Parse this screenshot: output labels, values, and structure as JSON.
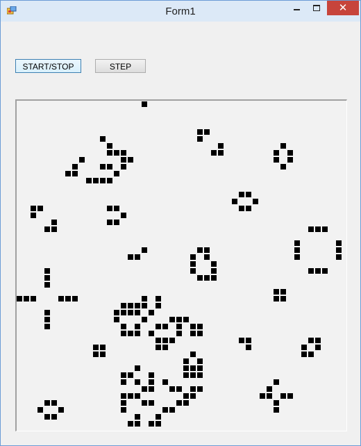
{
  "window": {
    "title": "Form1",
    "close_glyph": "✕"
  },
  "icons": {
    "app": "app-icon",
    "minimize": "minimize-icon",
    "maximize": "maximize-icon",
    "close": "close-icon"
  },
  "controls": {
    "start_stop_label": "START/STOP",
    "step_label": "STEP"
  },
  "colors": {
    "close_button": "#c7443b",
    "titlebar": "#dce9f7",
    "cell": "#000000",
    "board_bg": "#f2f2f2"
  },
  "board": {
    "live_cells": [
      [
        18,
        0
      ],
      [
        26,
        4
      ],
      [
        27,
        4
      ],
      [
        26,
        5
      ],
      [
        29,
        6
      ],
      [
        28,
        7
      ],
      [
        29,
        7
      ],
      [
        12,
        5
      ],
      [
        13,
        6
      ],
      [
        13,
        7
      ],
      [
        14,
        7
      ],
      [
        15,
        7
      ],
      [
        15,
        8
      ],
      [
        16,
        8
      ],
      [
        9,
        8
      ],
      [
        8,
        9
      ],
      [
        7,
        10
      ],
      [
        8,
        10
      ],
      [
        12,
        9
      ],
      [
        13,
        9
      ],
      [
        15,
        9
      ],
      [
        14,
        10
      ],
      [
        10,
        11
      ],
      [
        11,
        11
      ],
      [
        12,
        11
      ],
      [
        13,
        11
      ],
      [
        38,
        6
      ],
      [
        37,
        7
      ],
      [
        39,
        7
      ],
      [
        37,
        8
      ],
      [
        39,
        8
      ],
      [
        38,
        9
      ],
      [
        32,
        13
      ],
      [
        33,
        13
      ],
      [
        31,
        14
      ],
      [
        34,
        14
      ],
      [
        32,
        15
      ],
      [
        33,
        15
      ],
      [
        2,
        15
      ],
      [
        3,
        15
      ],
      [
        2,
        16
      ],
      [
        5,
        17
      ],
      [
        4,
        18
      ],
      [
        5,
        18
      ],
      [
        13,
        15
      ],
      [
        14,
        15
      ],
      [
        15,
        16
      ],
      [
        13,
        17
      ],
      [
        14,
        17
      ],
      [
        42,
        18
      ],
      [
        43,
        18
      ],
      [
        44,
        18
      ],
      [
        40,
        20
      ],
      [
        46,
        20
      ],
      [
        40,
        21
      ],
      [
        46,
        21
      ],
      [
        40,
        22
      ],
      [
        46,
        22
      ],
      [
        42,
        24
      ],
      [
        43,
        24
      ],
      [
        44,
        24
      ],
      [
        18,
        21
      ],
      [
        16,
        22
      ],
      [
        17,
        22
      ],
      [
        26,
        21
      ],
      [
        27,
        21
      ],
      [
        25,
        22
      ],
      [
        27,
        22
      ],
      [
        25,
        23
      ],
      [
        28,
        23
      ],
      [
        25,
        24
      ],
      [
        28,
        24
      ],
      [
        26,
        25
      ],
      [
        27,
        25
      ],
      [
        28,
        25
      ],
      [
        4,
        24
      ],
      [
        4,
        25
      ],
      [
        4,
        26
      ],
      [
        0,
        28
      ],
      [
        1,
        28
      ],
      [
        2,
        28
      ],
      [
        6,
        28
      ],
      [
        7,
        28
      ],
      [
        8,
        28
      ],
      [
        37,
        27
      ],
      [
        38,
        27
      ],
      [
        37,
        28
      ],
      [
        38,
        28
      ],
      [
        18,
        28
      ],
      [
        20,
        28
      ],
      [
        15,
        29
      ],
      [
        16,
        29
      ],
      [
        17,
        29
      ],
      [
        18,
        29
      ],
      [
        20,
        29
      ],
      [
        14,
        30
      ],
      [
        15,
        30
      ],
      [
        16,
        30
      ],
      [
        17,
        30
      ],
      [
        19,
        30
      ],
      [
        14,
        31
      ],
      [
        18,
        31
      ],
      [
        22,
        31
      ],
      [
        23,
        31
      ],
      [
        24,
        31
      ],
      [
        15,
        32
      ],
      [
        17,
        32
      ],
      [
        20,
        32
      ],
      [
        21,
        32
      ],
      [
        23,
        32
      ],
      [
        25,
        32
      ],
      [
        26,
        32
      ],
      [
        15,
        33
      ],
      [
        16,
        33
      ],
      [
        17,
        33
      ],
      [
        19,
        33
      ],
      [
        23,
        33
      ],
      [
        25,
        33
      ],
      [
        26,
        33
      ],
      [
        20,
        34
      ],
      [
        21,
        34
      ],
      [
        22,
        34
      ],
      [
        20,
        35
      ],
      [
        21,
        35
      ],
      [
        4,
        30
      ],
      [
        4,
        31
      ],
      [
        4,
        32
      ],
      [
        11,
        35
      ],
      [
        12,
        35
      ],
      [
        11,
        36
      ],
      [
        12,
        36
      ],
      [
        32,
        34
      ],
      [
        33,
        34
      ],
      [
        33,
        35
      ],
      [
        42,
        34
      ],
      [
        43,
        34
      ],
      [
        41,
        35
      ],
      [
        43,
        35
      ],
      [
        41,
        36
      ],
      [
        42,
        36
      ],
      [
        25,
        36
      ],
      [
        24,
        37
      ],
      [
        26,
        37
      ],
      [
        24,
        38
      ],
      [
        25,
        38
      ],
      [
        26,
        38
      ],
      [
        24,
        39
      ],
      [
        25,
        39
      ],
      [
        26,
        39
      ],
      [
        17,
        38
      ],
      [
        19,
        39
      ],
      [
        15,
        39
      ],
      [
        16,
        39
      ],
      [
        15,
        40
      ],
      [
        17,
        40
      ],
      [
        19,
        40
      ],
      [
        21,
        40
      ],
      [
        18,
        41
      ],
      [
        19,
        41
      ],
      [
        22,
        41
      ],
      [
        23,
        41
      ],
      [
        25,
        41
      ],
      [
        26,
        41
      ],
      [
        15,
        42
      ],
      [
        16,
        42
      ],
      [
        17,
        42
      ],
      [
        24,
        42
      ],
      [
        25,
        42
      ],
      [
        15,
        43
      ],
      [
        18,
        43
      ],
      [
        19,
        43
      ],
      [
        23,
        43
      ],
      [
        24,
        43
      ],
      [
        15,
        44
      ],
      [
        21,
        44
      ],
      [
        22,
        44
      ],
      [
        17,
        45
      ],
      [
        20,
        45
      ],
      [
        16,
        46
      ],
      [
        17,
        46
      ],
      [
        19,
        46
      ],
      [
        20,
        46
      ],
      [
        37,
        40
      ],
      [
        36,
        41
      ],
      [
        35,
        42
      ],
      [
        36,
        42
      ],
      [
        38,
        42
      ],
      [
        39,
        42
      ],
      [
        37,
        43
      ],
      [
        37,
        44
      ],
      [
        4,
        43
      ],
      [
        5,
        43
      ],
      [
        3,
        44
      ],
      [
        6,
        44
      ],
      [
        4,
        45
      ],
      [
        5,
        45
      ]
    ]
  }
}
